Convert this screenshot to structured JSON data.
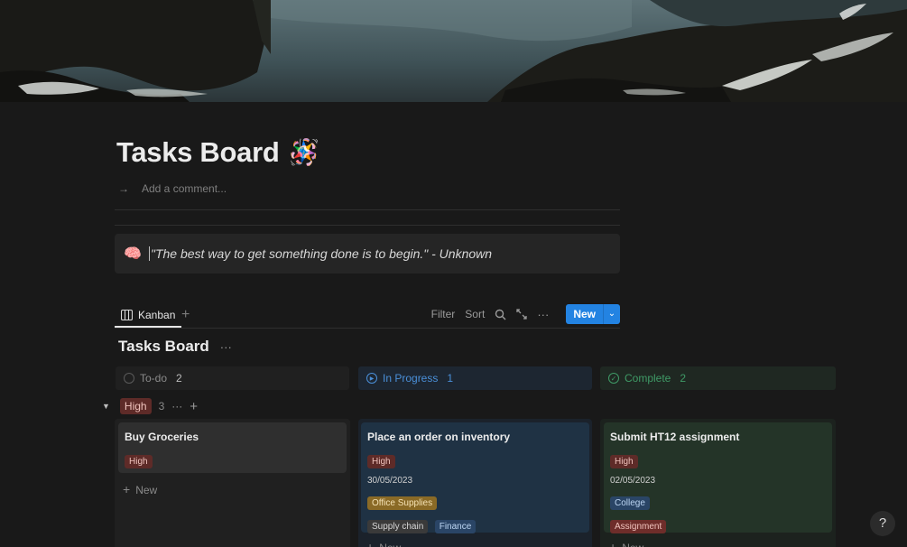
{
  "page": {
    "title": "Tasks Board",
    "title_emoji": "🪅",
    "comment_placeholder": "Add a comment..."
  },
  "callout": {
    "icon": "🧠",
    "text": "\"The best way to get something done is to begin.\" - Unknown"
  },
  "views": {
    "tabs": [
      {
        "label": "Kanban",
        "icon": "kanban-icon"
      }
    ],
    "filter": "Filter",
    "sort": "Sort",
    "new_label": "New"
  },
  "board": {
    "title": "Tasks Board",
    "columns": [
      {
        "label": "To-do",
        "count": "2",
        "color": "#9b9b9b"
      },
      {
        "label": "In Progress",
        "count": "1",
        "color": "#4a8fd8"
      },
      {
        "label": "Complete",
        "count": "2",
        "color": "#3f9a66"
      }
    ],
    "group": {
      "label": "High",
      "count": "3"
    },
    "cards": [
      {
        "title": "Buy Groceries",
        "priority": "High"
      },
      {
        "title": "Place an order on inventory",
        "priority": "High",
        "date": "30/05/2023",
        "tags": [
          "Office Supplies",
          "Supply chain",
          "Finance"
        ]
      },
      {
        "title": "Submit HT12 assignment",
        "priority": "High",
        "date": "02/05/2023",
        "tags": [
          "College",
          "Assignment"
        ]
      }
    ],
    "add_new": "New"
  },
  "help": "?"
}
